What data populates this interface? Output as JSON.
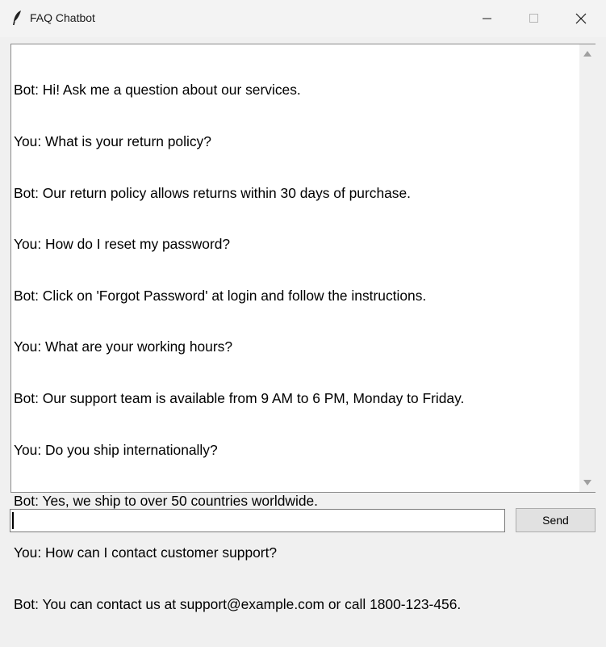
{
  "window": {
    "title": "FAQ Chatbot",
    "icon": "feather-icon"
  },
  "window_controls": {
    "minimize_icon": "minimize-icon",
    "maximize_icon": "maximize-icon",
    "close_icon": "close-icon"
  },
  "chat": {
    "lines": [
      "Bot: Hi! Ask me a question about our services.",
      "You: What is your return policy?",
      "Bot: Our return policy allows returns within 30 days of purchase.",
      "You: How do I reset my password?",
      "Bot: Click on 'Forgot Password' at login and follow the instructions.",
      "You: What are your working hours?",
      "Bot: Our support team is available from 9 AM to 6 PM, Monday to Friday.",
      "You: Do you ship internationally?",
      "Bot: Yes, we ship to over 50 countries worldwide.",
      "You: How can I contact customer support?",
      "Bot: You can contact us at support@example.com or call 1800-123-456."
    ]
  },
  "input": {
    "value": ""
  },
  "send_button": {
    "label": "Send"
  },
  "colors": {
    "window_bg": "#f0f0f0",
    "text_area_bg": "#ffffff",
    "button_bg": "#e1e1e1",
    "text": "#000000"
  }
}
